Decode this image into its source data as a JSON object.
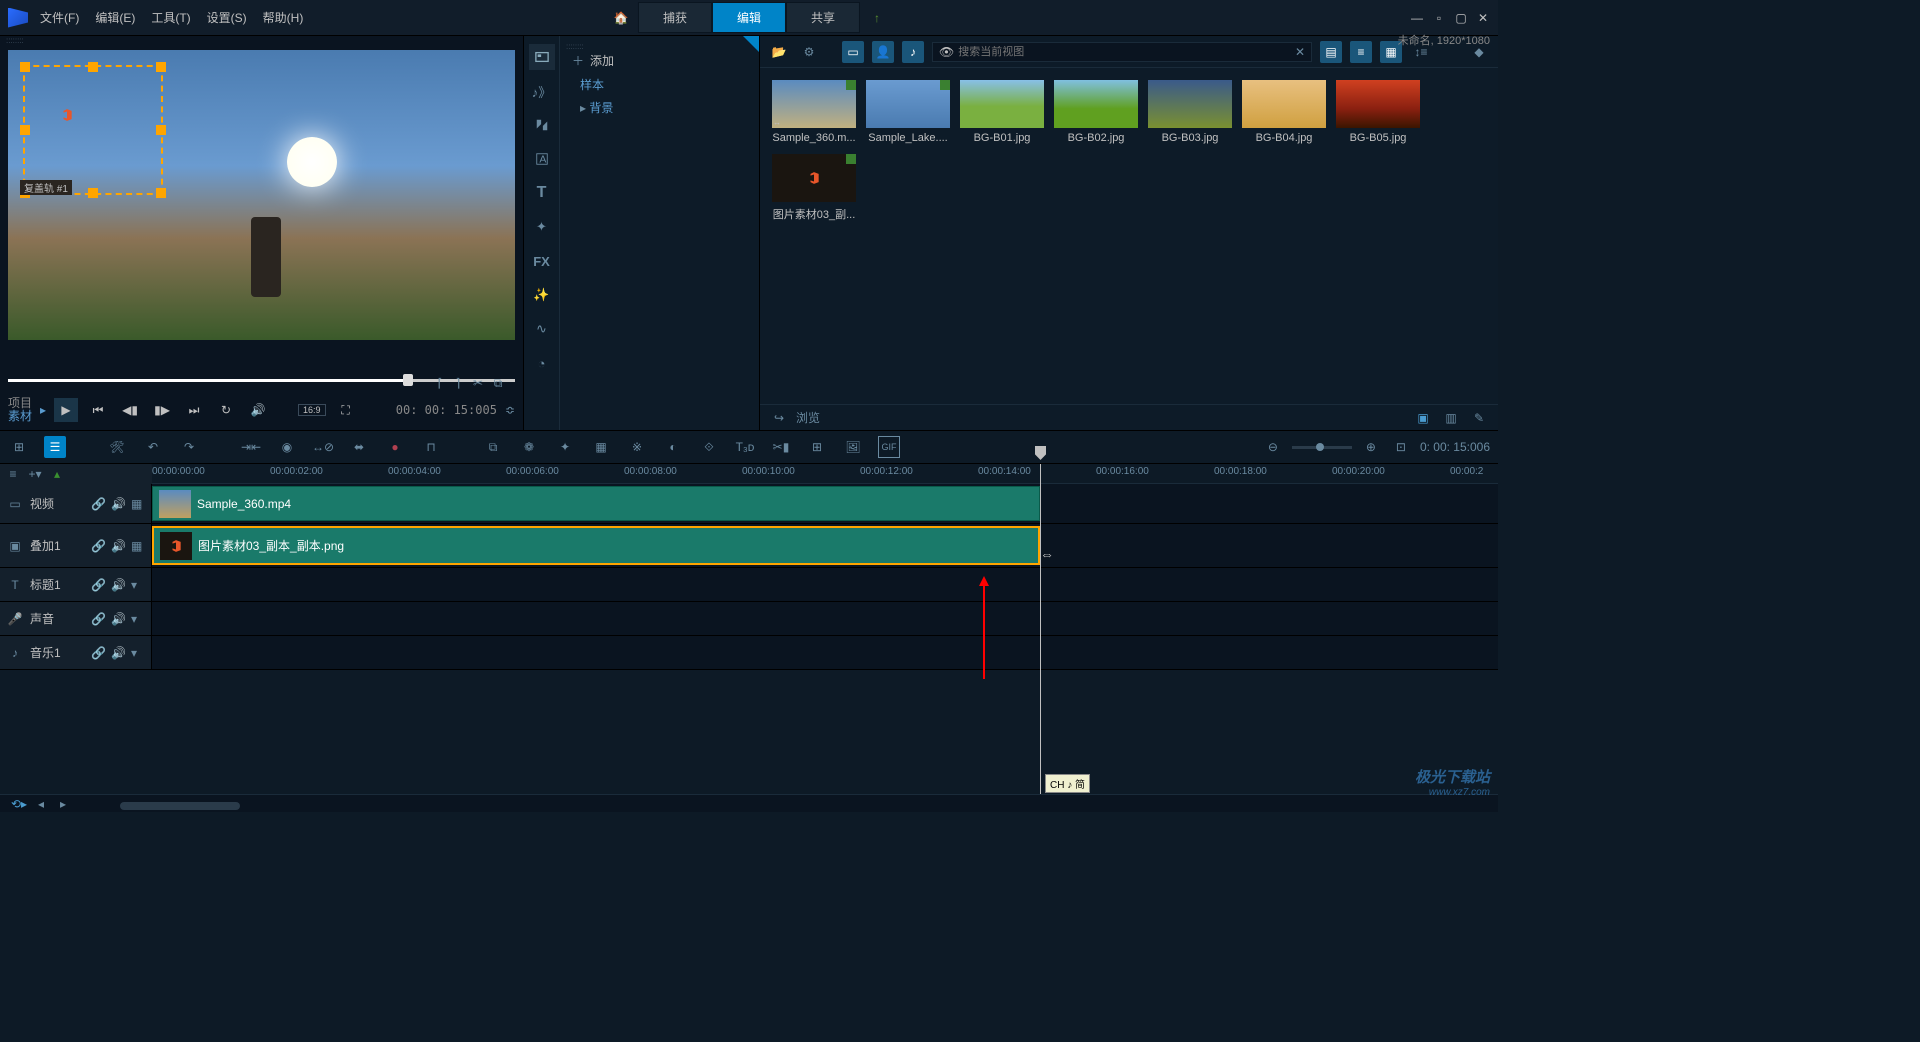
{
  "menubar": {
    "file": "文件(F)",
    "edit": "编辑(E)",
    "tools": "工具(T)",
    "settings": "设置(S)",
    "help": "帮助(H)"
  },
  "top_tabs": {
    "capture": "捕获",
    "edit": "编辑",
    "share": "共享"
  },
  "resolution": "未命名, 1920*1080",
  "preview": {
    "project_label1": "项目",
    "project_label2": "素材",
    "clip_label": "复盖轨 #1",
    "timecode": "00: 00: 15:005",
    "aspect_btn": "16:9"
  },
  "library": {
    "add": "添加",
    "tree": {
      "samples": "样本",
      "backgrounds": "背景"
    },
    "search_placeholder": "搜索当前视图",
    "browse": "浏览",
    "fx_label": "FX",
    "thumbs": [
      {
        "name": "Sample_360.m...",
        "cls": "g1",
        "checked": true
      },
      {
        "name": "Sample_Lake....",
        "cls": "g2",
        "checked": true
      },
      {
        "name": "BG-B01.jpg",
        "cls": "g3"
      },
      {
        "name": "BG-B02.jpg",
        "cls": "g4"
      },
      {
        "name": "BG-B03.jpg",
        "cls": "g5"
      },
      {
        "name": "BG-B04.jpg",
        "cls": "g6"
      },
      {
        "name": "BG-B05.jpg",
        "cls": "g7"
      },
      {
        "name": "图片素材03_副...",
        "cls": "g8",
        "checked": true
      }
    ]
  },
  "timeline": {
    "time_display": "0: 00: 15:006",
    "ruler": [
      "00:00:00:00",
      "00:00:02:00",
      "00:00:04:00",
      "00:00:06:00",
      "00:00:08:00",
      "00:00:10:00",
      "00:00:12:00",
      "00:00:14:00",
      "00:00:16:00",
      "00:00:18:00",
      "00:00:20:00",
      "00:00:2"
    ],
    "tracks": {
      "video": "视频",
      "overlay": "叠加1",
      "title": "标题1",
      "voice": "声音",
      "music": "音乐1"
    },
    "clips": {
      "video": "Sample_360.mp4",
      "overlay": "图片素材03_副本_副本.png"
    },
    "tooltip": "CH ♪ 简"
  },
  "watermark": {
    "line1": "极光下载站",
    "line2": "www.xz7.com"
  },
  "tool_text": {
    "t": "T",
    "t3d": "T₃ᴅ"
  }
}
